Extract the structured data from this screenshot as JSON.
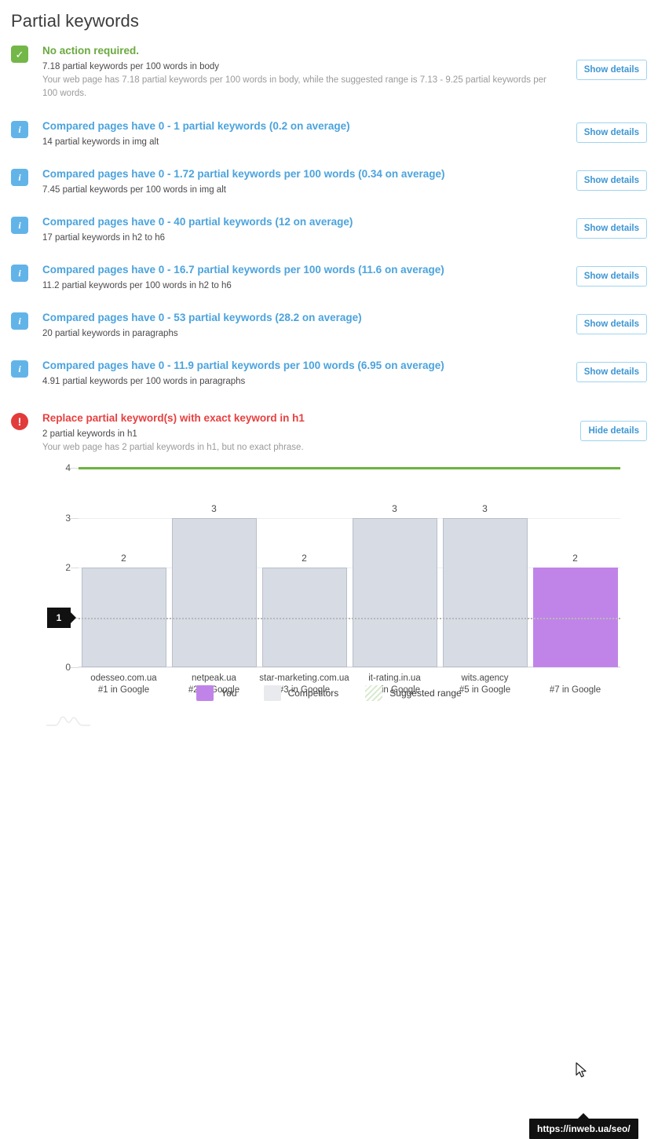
{
  "page": {
    "title": "Partial keywords"
  },
  "checks": [
    {
      "status": "ok",
      "icon": "check-icon",
      "title": "No action required.",
      "subtitle": "7.18 partial keywords per 100 words in body",
      "description": "Your web page has 7.18 partial keywords per 100 words in body, while the suggested range is 7.13 - 9.25 partial keywords per 100 words.",
      "action_label": "Show details"
    },
    {
      "status": "info",
      "icon": "info-icon",
      "title": "Compared pages have 0 - 1 partial keywords (0.2 on average)",
      "subtitle": "14 partial keywords in img alt",
      "description": "",
      "action_label": "Show details"
    },
    {
      "status": "info",
      "icon": "info-icon",
      "title": "Compared pages have 0 - 1.72 partial keywords per 100 words (0.34 on average)",
      "subtitle": "7.45 partial keywords per 100 words in img alt",
      "description": "",
      "action_label": "Show details"
    },
    {
      "status": "info",
      "icon": "info-icon",
      "title": "Compared pages have 0 - 40 partial keywords (12 on average)",
      "subtitle": "17 partial keywords in h2 to h6",
      "description": "",
      "action_label": "Show details"
    },
    {
      "status": "info",
      "icon": "info-icon",
      "title": "Compared pages have 0 - 16.7 partial keywords per 100 words (11.6 on average)",
      "subtitle": "11.2 partial keywords per 100 words in h2 to h6",
      "description": "",
      "action_label": "Show details"
    },
    {
      "status": "info",
      "icon": "info-icon",
      "title": "Compared pages have 0 - 53 partial keywords (28.2 on average)",
      "subtitle": "20 partial keywords in paragraphs",
      "description": "",
      "action_label": "Show details"
    },
    {
      "status": "info",
      "icon": "info-icon",
      "title": "Compared pages have 0 - 11.9 partial keywords per 100 words (6.95 on average)",
      "subtitle": "4.91 partial keywords per 100 words in paragraphs",
      "description": "",
      "action_label": "Show details"
    },
    {
      "status": "error",
      "icon": "error-icon",
      "title": "Replace partial keyword(s) with exact keyword in h1",
      "subtitle": "2 partial keywords in h1",
      "description": "Your web page has 2 partial keywords in h1, but no exact phrase.",
      "action_label": "Hide details"
    }
  ],
  "chart_data": {
    "type": "bar",
    "title": "",
    "xlabel": "",
    "ylabel": "",
    "ylim": [
      0,
      4
    ],
    "yticks": [
      0,
      1,
      2,
      3,
      4
    ],
    "grid": true,
    "categories": [
      "odesseo.com.ua",
      "netpeak.ua",
      "star-marketing.com.ua",
      "it-rating.in.ua",
      "wits.agency",
      "https://inweb.ua/seo/"
    ],
    "category_sublabels": [
      "#1 in Google",
      "#2 in Google",
      "#3 in Google",
      "#4 in Google",
      "#5 in Google",
      "#7 in Google"
    ],
    "values": [
      2,
      3,
      2,
      3,
      3,
      2
    ],
    "bar_types": [
      "competitor",
      "competitor",
      "competitor",
      "competitor",
      "competitor",
      "you"
    ],
    "target_line": 1,
    "target_badge_label": "1",
    "suggested_range_line": 4,
    "tooltip": "https://inweb.ua/seo/",
    "legend_position": "bottom"
  },
  "legend": [
    {
      "label": "You",
      "swatch": "you",
      "color": "#c084e8"
    },
    {
      "label": "Competitors",
      "swatch": "competitors",
      "color": "#e8eaee"
    },
    {
      "label": "Suggested range",
      "swatch": "range",
      "color": "#6cb33f"
    }
  ],
  "colors": {
    "ok": "#6aa93f",
    "info": "#4ba3dd",
    "error": "#e8403f",
    "you": "#c084e8",
    "competitors": "#d6dbe4",
    "range": "#6cb33f",
    "tooltip_bg": "#111111"
  }
}
